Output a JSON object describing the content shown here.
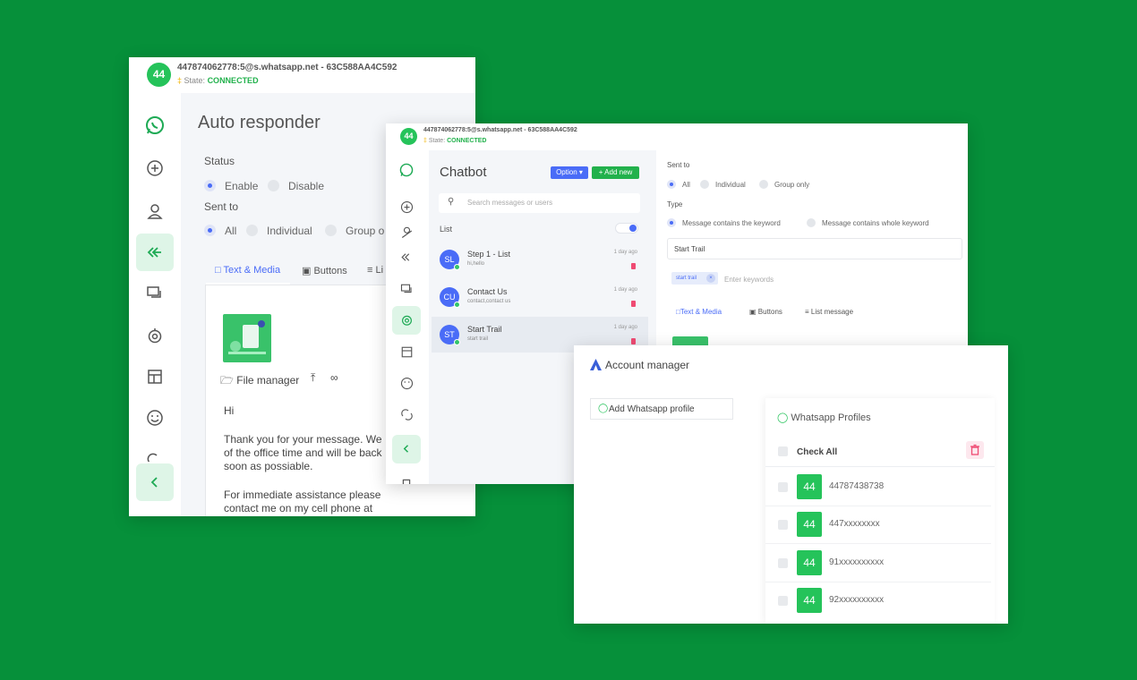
{
  "autoresponder": {
    "avatar": "44",
    "jid": "447874062778:5@s.whatsapp.net - 63C588AA4C592",
    "state_label": "State:",
    "state_value": "CONNECTED",
    "title": "Auto responder",
    "status_label": "Status",
    "status_options": [
      "Enable",
      "Disable"
    ],
    "sent_to_label": "Sent to",
    "sent_to_options": [
      "All",
      "Individual",
      "Group o"
    ],
    "tabs": [
      "Text & Media",
      "Buttons",
      "Li"
    ],
    "file_manager_label": "File manager",
    "message_lines": [
      "Hi",
      "Thank you for your message. We",
      "of the office time and will be back",
      "soon as possiable.",
      "For immediate assistance please",
      "contact me on my cell phone at"
    ]
  },
  "chatbot": {
    "avatar": "44",
    "jid": "447874062778:5@s.whatsapp.net - 63C588AA4C592",
    "state_label": "State:",
    "state_value": "CONNECTED",
    "title": "Chatbot",
    "option_label": "Option",
    "add_new_label": "Add new",
    "search_placeholder": "Search messages or users",
    "list_label": "List",
    "items": [
      {
        "initials": "SL",
        "name": "Step 1 - List",
        "sub": "hi,hello",
        "time": "1 day ago"
      },
      {
        "initials": "CU",
        "name": "Contact Us",
        "sub": "contact,contact us",
        "time": "1 day ago"
      },
      {
        "initials": "ST",
        "name": "Start Trail",
        "sub": "start trail",
        "time": "1 day ago"
      }
    ],
    "sent_to_label": "Sent to",
    "sent_to_options": [
      "All",
      "Individual",
      "Group only"
    ],
    "type_label": "Type",
    "type_options": [
      "Message contains the keyword",
      "Message contains whole keyword"
    ],
    "name_value": "Start Trail",
    "keyword_chip": "start trail",
    "keywords_placeholder": "Enter keywords",
    "tabs": [
      "Text & Media",
      "Buttons",
      "List message"
    ]
  },
  "account": {
    "title": "Account manager",
    "add_profile_label": "Add Whatsapp profile",
    "profiles_title": "Whatsapp Profiles",
    "check_all_label": "Check All",
    "profiles": [
      {
        "badge": "44",
        "number": "44787438738"
      },
      {
        "badge": "44",
        "number": "447xxxxxxxx"
      },
      {
        "badge": "44",
        "number": "91xxxxxxxxxx"
      },
      {
        "badge": "44",
        "number": "92xxxxxxxxxx"
      }
    ]
  },
  "colors": {
    "background": "#06903a",
    "whatsapp_green": "#25c35a",
    "accent_blue": "#4a6cf7",
    "delete_pink": "#ef4b73"
  }
}
